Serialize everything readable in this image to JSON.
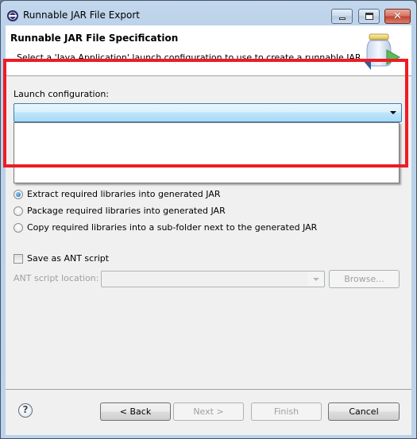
{
  "window": {
    "title": "Runnable JAR File Export",
    "controls": {
      "minimize": "minimize",
      "maximize": "maximize",
      "close": "✕"
    }
  },
  "header": {
    "title": "Runnable JAR File Specification",
    "description": "Select a 'Java Application' launch configuration to use to create a runnable JAR.",
    "icon": "jar-export-icon"
  },
  "launch_configuration": {
    "label": "Launch configuration:",
    "value": "",
    "dropdown_open": true,
    "options": []
  },
  "library_handling": {
    "options": [
      {
        "label": "Extract required libraries into generated JAR",
        "checked": true
      },
      {
        "label": "Package required libraries into generated JAR",
        "checked": false
      },
      {
        "label": "Copy required libraries into a sub-folder next to the generated JAR",
        "checked": false
      }
    ]
  },
  "ant": {
    "save_label": "Save as ANT script",
    "save_checked": false,
    "location_label": "ANT script location:",
    "location_value": "",
    "browse_label": "Browse..."
  },
  "footer": {
    "help_icon": "?",
    "back_label": "< Back",
    "next_label": "Next >",
    "finish_label": "Finish",
    "cancel_label": "Cancel"
  },
  "annotation": {
    "highlight_color": "#ed1c24"
  }
}
